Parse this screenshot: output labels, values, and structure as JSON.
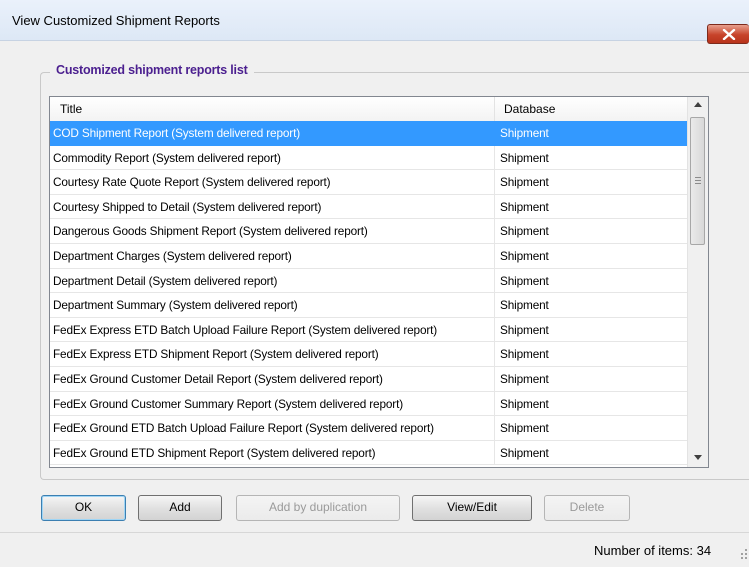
{
  "window": {
    "title": "View Customized Shipment Reports",
    "close_icon": "close-icon"
  },
  "group": {
    "legend": "Customized shipment reports list"
  },
  "list": {
    "columns": [
      "Title",
      "Database"
    ],
    "selected_index": 0,
    "rows": [
      {
        "title": "COD Shipment Report (System delivered report)",
        "database": "Shipment"
      },
      {
        "title": "Commodity Report (System delivered report)",
        "database": "Shipment"
      },
      {
        "title": "Courtesy Rate Quote Report (System delivered report)",
        "database": "Shipment"
      },
      {
        "title": "Courtesy Shipped to Detail (System delivered report)",
        "database": "Shipment"
      },
      {
        "title": "Dangerous Goods Shipment Report (System delivered report)",
        "database": "Shipment"
      },
      {
        "title": "Department Charges (System delivered report)",
        "database": "Shipment"
      },
      {
        "title": "Department Detail (System delivered report)",
        "database": "Shipment"
      },
      {
        "title": "Department Summary (System delivered report)",
        "database": "Shipment"
      },
      {
        "title": "FedEx Express ETD Batch Upload Failure Report (System delivered report)",
        "database": "Shipment"
      },
      {
        "title": "FedEx Express ETD Shipment Report (System delivered report)",
        "database": "Shipment"
      },
      {
        "title": "FedEx Ground Customer Detail Report (System delivered report)",
        "database": "Shipment"
      },
      {
        "title": "FedEx Ground Customer Summary Report (System delivered report)",
        "database": "Shipment"
      },
      {
        "title": "FedEx Ground ETD Batch Upload Failure Report (System delivered report)",
        "database": "Shipment"
      },
      {
        "title": "FedEx Ground ETD Shipment Report (System delivered report)",
        "database": "Shipment"
      }
    ]
  },
  "buttons": {
    "ok": "OK",
    "add": "Add",
    "add_dup": "Add by duplication",
    "view_edit": "View/Edit",
    "delete": "Delete"
  },
  "status": {
    "items_label": "Number of items:",
    "items_count": "34"
  },
  "colors": {
    "selection": "#3399ff",
    "legend_text": "#4b1f8f",
    "close_button": "#c7432a"
  }
}
